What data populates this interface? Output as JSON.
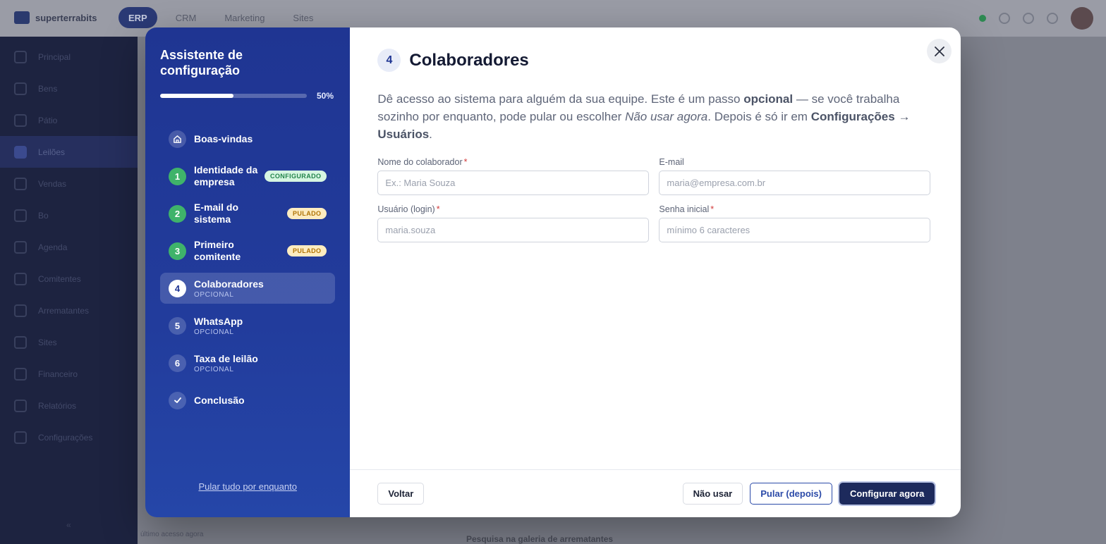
{
  "background": {
    "brand": "superterrabits",
    "nav": [
      "ERP",
      "CRM",
      "Marketing",
      "Sites"
    ],
    "sidebar": [
      "Principal",
      "Bens",
      "Pátio",
      "Leilões",
      "Vendas",
      "Bo",
      "Agenda",
      "Comitentes",
      "Arrematantes",
      "Sites",
      "Financeiro",
      "Relatórios",
      "Configurações"
    ],
    "footer_text": "Pesquisa na galeria de arrematantes",
    "footer_small": "último acesso agora"
  },
  "wizard": {
    "title": "Assistente de configuração",
    "progress_fraction": 0.5,
    "progress_label": "50%",
    "steps": [
      {
        "marker": "",
        "label": "Boas-vindas",
        "sub": "",
        "badge": "",
        "state": "neutral",
        "icon": "home-icon"
      },
      {
        "marker": "1",
        "label": "Identidade da empresa",
        "sub": "",
        "badge": "CONFIGURADO",
        "state": "done"
      },
      {
        "marker": "2",
        "label": "E-mail do sistema",
        "sub": "",
        "badge": "PULADO",
        "state": "done"
      },
      {
        "marker": "3",
        "label": "Primeiro comitente",
        "sub": "",
        "badge": "PULADO",
        "state": "done"
      },
      {
        "marker": "4",
        "label": "Colaboradores",
        "sub": "OPCIONAL",
        "badge": "",
        "state": "current"
      },
      {
        "marker": "5",
        "label": "WhatsApp",
        "sub": "OPCIONAL",
        "badge": "",
        "state": "neutral"
      },
      {
        "marker": "6",
        "label": "Taxa de leilão",
        "sub": "OPCIONAL",
        "badge": "",
        "state": "neutral"
      },
      {
        "marker": "",
        "label": "Conclusão",
        "sub": "",
        "badge": "",
        "state": "neutral",
        "icon": "check-icon"
      }
    ],
    "skip_all_label": "Pular tudo por enquanto"
  },
  "main": {
    "step_number": "4",
    "title": "Colaboradores",
    "description": {
      "p1": "Dê acesso ao sistema para alguém da sua equipe. Este é um passo ",
      "b1": "opcional",
      "p2": " — se você trabalha sozinho por enquanto, pode pular ou escolher ",
      "i1": "Não usar agora",
      "p3": ". Depois é só ir em ",
      "b2": "Configurações → Usuários",
      "p4": "."
    },
    "fields": {
      "name": {
        "label": "Nome do colaborador",
        "required": "*",
        "placeholder": "Ex.: Maria Souza",
        "value": ""
      },
      "email": {
        "label": "E-mail",
        "required": "",
        "placeholder": "maria@empresa.com.br",
        "value": ""
      },
      "username": {
        "label": "Usuário (login)",
        "required": "*",
        "placeholder": "maria.souza",
        "value": ""
      },
      "password": {
        "label": "Senha inicial",
        "required": "*",
        "placeholder": "mínimo 6 caracteres",
        "value": ""
      }
    }
  },
  "footer": {
    "back_label": "Voltar",
    "dont_use_label": "Não usar",
    "skip_later_label": "Pular (depois)",
    "configure_now_label": "Configurar agora"
  },
  "colors": {
    "sidebar_gradient_start": "#1f3592",
    "sidebar_gradient_end": "#2546a8",
    "primary_button": "#1d2a5c",
    "done_step": "#3fb36a",
    "badge_ok_bg": "#d6f5e1",
    "badge_skip_bg": "#fdecc0",
    "required_mark": "#d23b3b"
  }
}
